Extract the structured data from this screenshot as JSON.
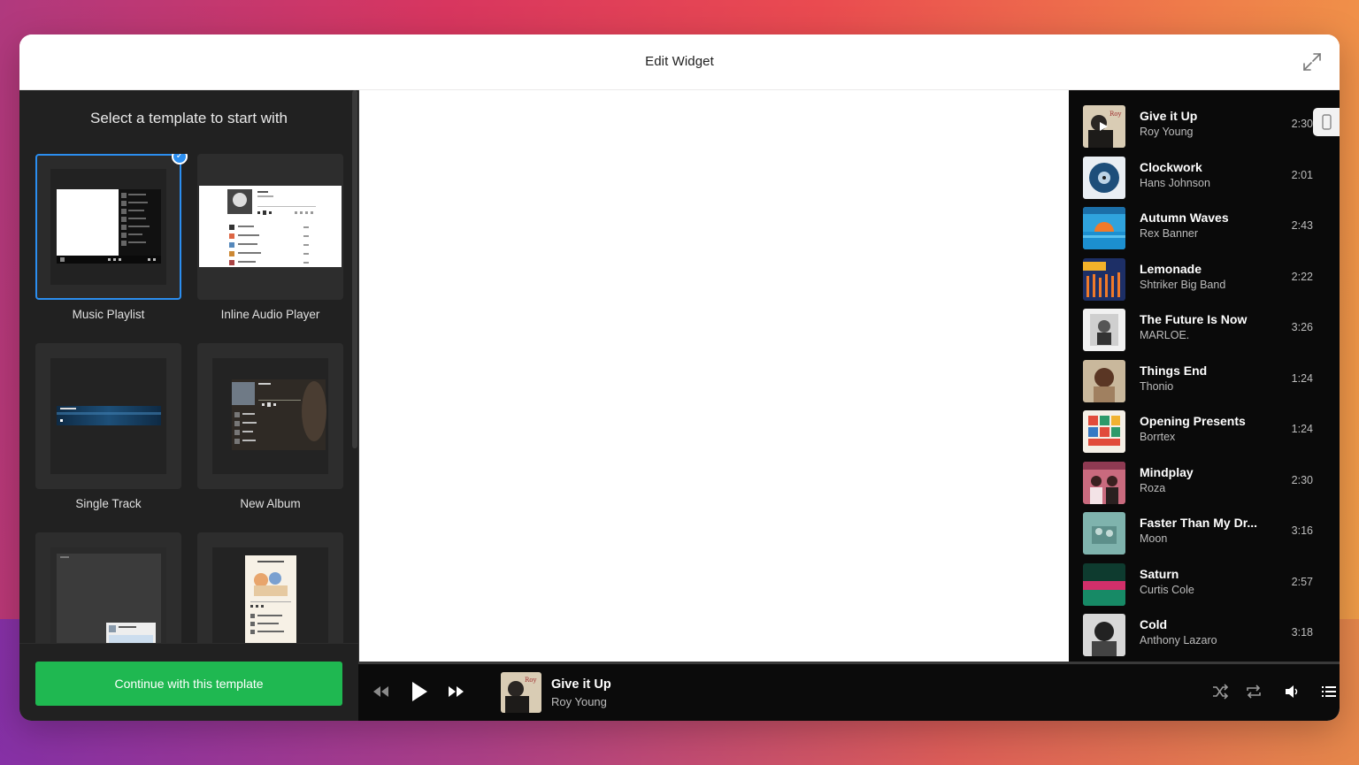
{
  "window": {
    "title": "Edit Widget"
  },
  "sidebar": {
    "heading": "Select a template to start with",
    "templates": [
      {
        "label": "Music Playlist",
        "selected": true
      },
      {
        "label": "Inline Audio Player",
        "selected": false
      },
      {
        "label": "Single Track",
        "selected": false
      },
      {
        "label": "New Album",
        "selected": false
      },
      {
        "label": "",
        "selected": false
      },
      {
        "label": "",
        "selected": false
      }
    ],
    "continue_label": "Continue with this template"
  },
  "playlist": {
    "tracks": [
      {
        "title": "Give it Up",
        "artist": "Roy Young",
        "duration": "2:30"
      },
      {
        "title": "Clockwork",
        "artist": "Hans Johnson",
        "duration": "2:01"
      },
      {
        "title": "Autumn Waves",
        "artist": "Rex Banner",
        "duration": "2:43"
      },
      {
        "title": "Lemonade",
        "artist": "Shtriker Big Band",
        "duration": "2:22"
      },
      {
        "title": "The Future Is Now",
        "artist": "MARLOE.",
        "duration": "3:26"
      },
      {
        "title": "Things End",
        "artist": "Thonio",
        "duration": "1:24"
      },
      {
        "title": "Opening Presents",
        "artist": "Borrtex",
        "duration": "1:24"
      },
      {
        "title": "Mindplay",
        "artist": "Roza",
        "duration": "2:30"
      },
      {
        "title": "Faster Than My Dr...",
        "artist": "Moon",
        "duration": "3:16"
      },
      {
        "title": "Saturn",
        "artist": "Curtis Cole",
        "duration": "2:57"
      },
      {
        "title": "Cold",
        "artist": "Anthony Lazaro",
        "duration": "3:18"
      }
    ]
  },
  "player": {
    "now_playing_title": "Give it Up",
    "now_playing_artist": "Roy Young"
  },
  "icons": {
    "expand": "expand-icon",
    "rewind": "rewind-icon",
    "play": "play-icon",
    "forward": "fast-forward-icon",
    "shuffle": "shuffle-icon",
    "repeat": "repeat-icon",
    "volume": "volume-icon",
    "list": "list-icon"
  },
  "colors": {
    "accent_green": "#1fb851",
    "select_blue": "#2b8ef0",
    "sidebar_bg": "#212121",
    "playlist_bg": "#0a0a0a"
  }
}
